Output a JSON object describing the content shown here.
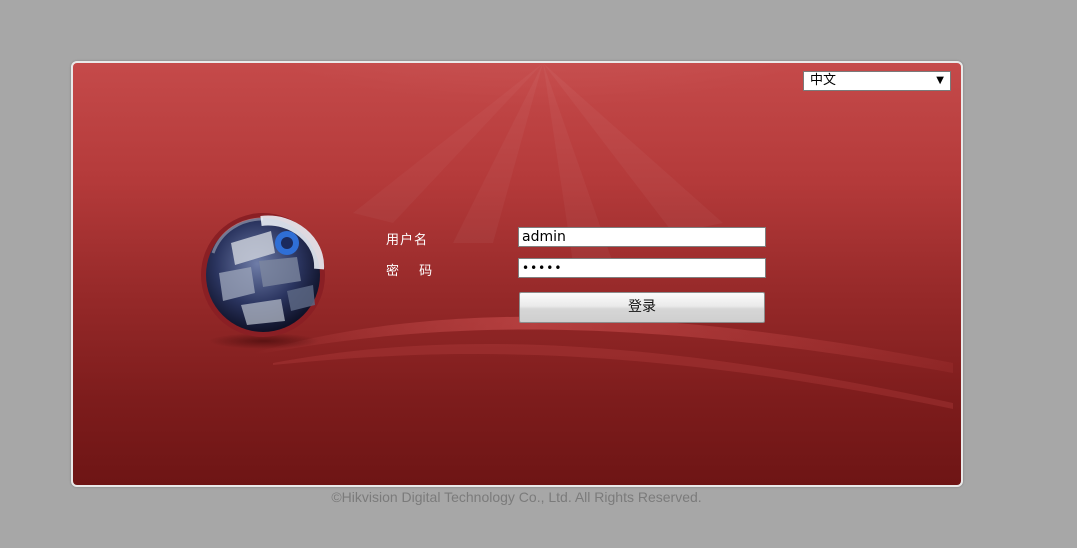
{
  "language": {
    "selected": "中文"
  },
  "form": {
    "username_label": "用户名",
    "password_label": "密 码",
    "username_value": "admin",
    "password_mask": "•••••",
    "login_label": "登录"
  },
  "footer": {
    "copyright": "©Hikvision Digital Technology Co., Ltd. All Rights Reserved."
  },
  "colors": {
    "panel_top": "#c54a4a",
    "panel_bottom": "#6e1515",
    "page_bg": "#a7a7a7"
  },
  "icons": {
    "logo": "camera-globe-logo"
  }
}
